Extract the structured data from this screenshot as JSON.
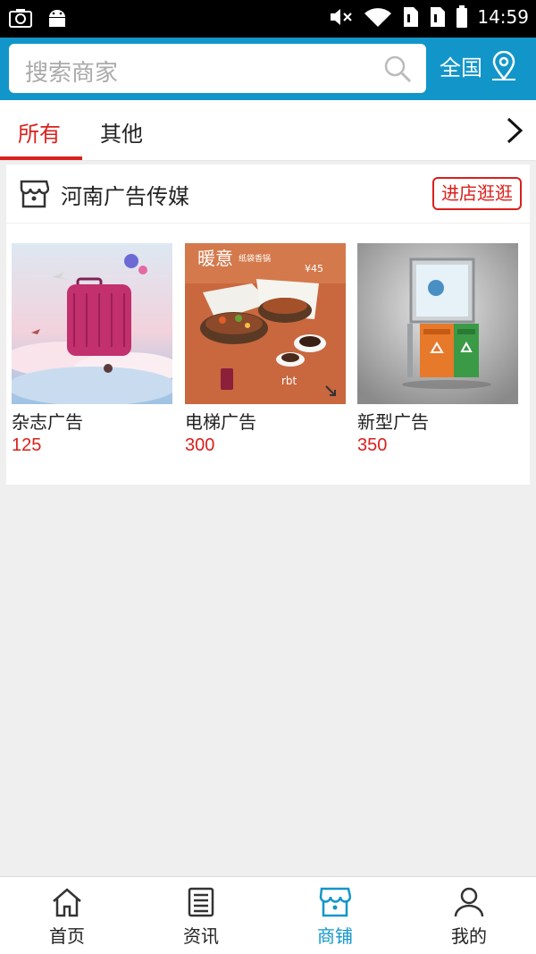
{
  "status_bar": {
    "time": "14:59"
  },
  "header": {
    "search_placeholder": "搜索商家",
    "region_label": "全国",
    "accent_color": "#1296c9"
  },
  "tabs": {
    "items": [
      {
        "label": "所有",
        "active": true
      },
      {
        "label": "其他",
        "active": false
      }
    ]
  },
  "shop": {
    "name": "河南广告传媒",
    "visit_button": "进店逛逛",
    "products": [
      {
        "name": "杂志广告",
        "price": "125"
      },
      {
        "name": "电梯广告",
        "price": "300"
      },
      {
        "name": "新型广告",
        "price": "350"
      }
    ]
  },
  "product_images": {
    "elevator_ad": {
      "title": "暖意",
      "subtitle": "纸袋香锅",
      "price_tag": "¥45",
      "brand": "rbt"
    }
  },
  "bottom_nav": {
    "items": [
      {
        "label": "首页",
        "icon": "home-icon",
        "active": false
      },
      {
        "label": "资讯",
        "icon": "news-icon",
        "active": false
      },
      {
        "label": "商铺",
        "icon": "store-icon",
        "active": true
      },
      {
        "label": "我的",
        "icon": "user-icon",
        "active": false
      }
    ]
  }
}
